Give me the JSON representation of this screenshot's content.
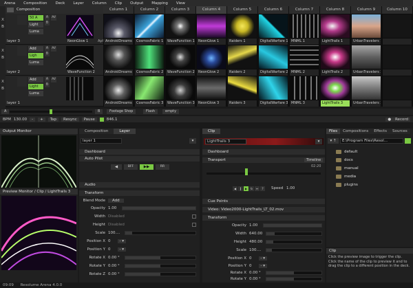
{
  "menu": [
    "Arena",
    "Composition",
    "Deck",
    "Layer",
    "Column",
    "Clip",
    "Output",
    "Mapping",
    "View"
  ],
  "columns": [
    "Column 1",
    "Column 2",
    "Column 3",
    "Column 4",
    "Column 5",
    "Column 6",
    "Column 7",
    "Column 8",
    "Column 9",
    "Column 10"
  ],
  "composition_label": "Composition",
  "layers": [
    {
      "name": "layer 3",
      "blend": "50 A",
      "pill2": "Light",
      "pill3": "Luma",
      "layer_clip": "NeonGlow 1",
      "aph": "Aph",
      "clips": [
        "AndroidDreams 1",
        "CosmosFabric 1",
        "WaveFunction 1",
        "NeonGlow 1",
        "Raiders 1",
        "DigitalWarfare 1",
        "MNML 1",
        "LightTrails 1",
        "UrbanTravelers 1",
        ""
      ]
    },
    {
      "name": "layer 2",
      "blend": "Add",
      "pill2": "Ligh",
      "pill3": "Luma",
      "layer_clip": "WaveFunction 2",
      "aph": "",
      "clips": [
        "AndroidDreams 2",
        "CosmosFabric 2",
        "WaveFunction 2",
        "NeonGlow 2",
        "Raiders 2",
        "DigitalWarfare 2",
        "MNML 2",
        "LightTrails 2",
        "UrbanTravelers 2",
        ""
      ]
    },
    {
      "name": "layer 1",
      "blend": "Add",
      "pill2": "Light",
      "pill3": "Luma",
      "layer_clip": "",
      "aph": "",
      "clips": [
        "AndroidDreams 3",
        "CosmosFabric 3",
        "WaveFunction 3",
        "NeonGlow 3",
        "Raiders 3",
        "DigitalWarfare 3",
        "MNML 3",
        "LightTrails 3",
        "UrbanTravelers 3",
        ""
      ]
    }
  ],
  "deck": {
    "a": "A",
    "b": "B",
    "tabs": [
      "Footage Shop",
      "Flash",
      "empty"
    ]
  },
  "bpm": {
    "label": "BPM",
    "value": "130.00",
    "tap": "Tap",
    "resync": "Resync",
    "pause": "Pause",
    "counter": "846.1",
    "record": "Record"
  },
  "output_monitor": {
    "title": "Output Monitor",
    "preview": "Preview Monitor / Clip / LightTrails 3"
  },
  "layer_panel": {
    "tabs": [
      "Composition",
      "Layer"
    ],
    "layer_name": "layer 1",
    "sections": [
      "Dashboard",
      "Auto Pilot",
      "Audio",
      "Transform"
    ],
    "autopilot_buttons": [
      "BFF",
      "▶▶",
      "RR"
    ],
    "blend_label": "Blend Mode",
    "blend_value": "Add",
    "params": [
      {
        "k": "Opacity",
        "v": "1.00"
      },
      {
        "k": "Width",
        "v": "Disabled"
      },
      {
        "k": "Height",
        "v": "Disabled"
      },
      {
        "k": "Scale",
        "v": "100...."
      },
      {
        "k": "Position X",
        "v": "0"
      },
      {
        "k": "Position Y",
        "v": "0"
      },
      {
        "k": "Rotate X",
        "v": "0.00 °"
      },
      {
        "k": "Rotate Y",
        "v": "0.00 °"
      },
      {
        "k": "Rotate Z",
        "v": "0.00 °"
      }
    ]
  },
  "clip_panel": {
    "tab": "Clip",
    "clip_name": "LightTrails 3",
    "sections": [
      "Dashboard",
      "Transport",
      "Cue Points",
      "Video: Video2000-LightTrails_LT_02.mov",
      "Transform"
    ],
    "timeline": "Timeline",
    "time": "02:20",
    "speed_label": "Speed",
    "speed_value": "1.00",
    "params": [
      {
        "k": "Opacity",
        "v": "1.00"
      },
      {
        "k": "Width",
        "v": "640.00"
      },
      {
        "k": "Height",
        "v": "480.00"
      },
      {
        "k": "Scale",
        "v": "100...."
      },
      {
        "k": "Position X",
        "v": "0"
      },
      {
        "k": "Position Y",
        "v": "0"
      },
      {
        "k": "Rotate X",
        "v": "0.00 °"
      },
      {
        "k": "Rotate Y",
        "v": "0.00 °"
      },
      {
        "k": "Rotate Z",
        "v": "0.00 °"
      }
    ]
  },
  "files": {
    "tabs": [
      "Files",
      "Compositions",
      "Effects",
      "Sources"
    ],
    "path": "E:\\Program Files\\Resol...",
    "items": [
      "default",
      "docs",
      "manual",
      "media",
      "plugins"
    ]
  },
  "clip_help": {
    "title": "Clip",
    "text": "Click the preview image to trigger the clip. Click the name of the clip to preview it and to drag the clip to a different position in the deck."
  },
  "status": {
    "time": "09:09",
    "app": "Resolume Arena 4.0.0"
  },
  "colors": {
    "accent": "#9ade5a",
    "clip_bar": "#8b1a1a"
  }
}
